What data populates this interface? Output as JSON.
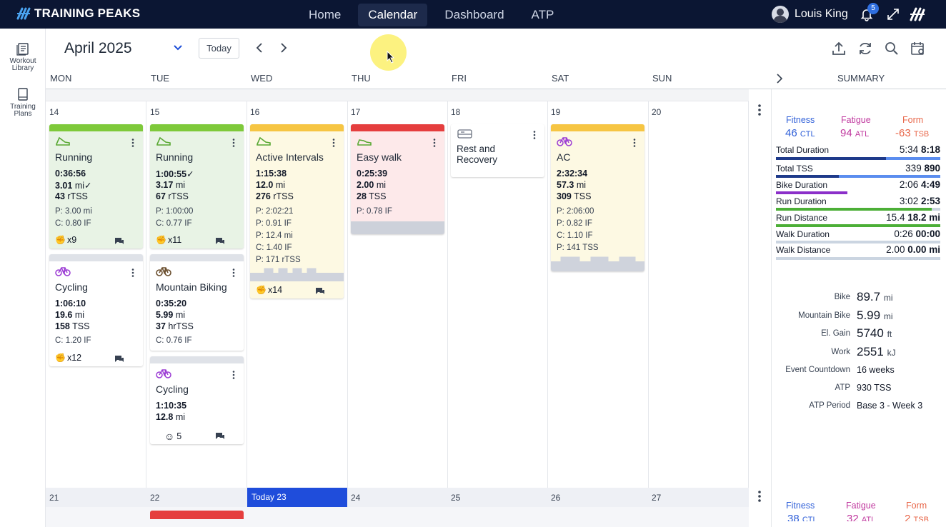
{
  "app": {
    "brand": "TRAINING PEAKS"
  },
  "nav": {
    "home": "Home",
    "calendar": "Calendar",
    "dashboard": "Dashboard",
    "atp": "ATP"
  },
  "user": {
    "name": "Louis King",
    "notifications": "5"
  },
  "leftbar": {
    "workout_library_1": "Workout",
    "workout_library_2": "Library",
    "training_plans_1": "Training",
    "training_plans_2": "Plans"
  },
  "header": {
    "month": "April 2025",
    "today_btn": "Today"
  },
  "days": [
    "MON",
    "TUE",
    "WED",
    "THU",
    "FRI",
    "SAT",
    "SUN"
  ],
  "summary_label": "SUMMARY",
  "week1": {
    "nums": [
      "14",
      "15",
      "16",
      "17",
      "18",
      "19",
      "20"
    ]
  },
  "week2": {
    "nums": [
      "21",
      "22",
      "Today 23",
      "24",
      "25",
      "26",
      "27"
    ]
  },
  "cards": {
    "mon_run": {
      "title": "Running",
      "dur": "0:36:56",
      "dist": "3.01",
      "dist_unit": "mi",
      "tss": "43",
      "tss_unit": "rTSS",
      "p": "P: 3.00 mi",
      "c": "C: 0.80 IF",
      "likes": "x9"
    },
    "mon_cyc": {
      "title": "Cycling",
      "dur": "1:06:10",
      "dist": "19.6",
      "dist_unit": "mi",
      "tss": "158",
      "tss_unit": "TSS",
      "c": "C: 1.20 IF",
      "likes": "x12"
    },
    "tue_run": {
      "title": "Running",
      "dur": "1:00:55",
      "dist": "3.17",
      "dist_unit": "mi",
      "tss": "67",
      "tss_unit": "rTSS",
      "p": "P: 1:00:00",
      "c": "C: 0.77 IF",
      "likes": "x11"
    },
    "tue_mtb": {
      "title": "Mountain Biking",
      "dur": "0:35:20",
      "dist": "5.99",
      "dist_unit": "mi",
      "tss": "37",
      "tss_unit": "hrTSS",
      "c": "C: 0.76 IF"
    },
    "tue_cyc": {
      "title": "Cycling",
      "dur": "1:10:35",
      "dist": "12.8",
      "dist_unit": "mi",
      "likes": "5"
    },
    "wed": {
      "title": "Active Intervals",
      "dur": "1:15:38",
      "dist": "12.0",
      "dist_unit": "mi",
      "tss": "276",
      "tss_unit": "rTSS",
      "p1": "P: 2:02:21",
      "p2": "P: 0.91 IF",
      "p3": "P: 12.4 mi",
      "c": "C: 1.40 IF",
      "p4": "P: 171 rTSS",
      "likes": "x14"
    },
    "thu": {
      "title": "Easy walk",
      "dur": "0:25:39",
      "dist": "2.00",
      "dist_unit": "mi",
      "tss": "28",
      "tss_unit": "TSS",
      "p": "P: 0.78 IF"
    },
    "fri": {
      "title1": "Rest and",
      "title2": "Recovery"
    },
    "sat": {
      "title": "AC",
      "dur": "2:32:34",
      "dist": "57.3",
      "dist_unit": "mi",
      "tss": "309",
      "tss_unit": "TSS",
      "p1": "P: 2:06:00",
      "p2": "P: 0.82 IF",
      "c": "C: 1.10 IF",
      "p3": "P: 141 TSS"
    }
  },
  "summary": {
    "fitness_label": "Fitness",
    "fitness_val": "46",
    "fitness_unit": "CTL",
    "fatigue_label": "Fatigue",
    "fatigue_val": "94",
    "fatigue_unit": "ATL",
    "form_label": "Form",
    "form_val": "-63",
    "form_unit": "TSB",
    "rows": [
      {
        "label": "Total Duration",
        "a": "5:34",
        "b": "8:18"
      },
      {
        "label": "Total TSS",
        "a": "339",
        "b": "890"
      },
      {
        "label": "Bike Duration",
        "a": "2:06",
        "b": "4:49"
      },
      {
        "label": "Run Duration",
        "a": "3:02",
        "b": "2:53"
      },
      {
        "label": "Run Distance",
        "a": "15.4",
        "b": "18.2 mi"
      },
      {
        "label": "Walk Duration",
        "a": "0:26",
        "b": "00:00"
      },
      {
        "label": "Walk Distance",
        "a": "2.00",
        "b": "0.00 mi"
      }
    ],
    "stats": [
      {
        "label": "Bike",
        "value": "89.7",
        "unit": "mi"
      },
      {
        "label": "Mountain Bike",
        "value": "5.99",
        "unit": "mi"
      },
      {
        "label": "El. Gain",
        "value": "5740",
        "unit": "ft"
      },
      {
        "label": "Work",
        "value": "2551",
        "unit": "kJ"
      },
      {
        "label": "Event Countdown",
        "value": "16 weeks",
        "unit": ""
      },
      {
        "label": "ATP",
        "value": "930",
        "unit": "TSS"
      },
      {
        "label": "ATP Period",
        "value": "Base 3 - Week 3",
        "unit": ""
      }
    ],
    "week2_fitness": "38",
    "week2_fitness_unit": "CTL",
    "week2_fatigue": "32",
    "week2_fatigue_unit": "ATL",
    "week2_form": "2",
    "week2_form_unit": "TSB"
  },
  "colors": {
    "navy": "#0b1633",
    "green": "#7ec93a",
    "yellow": "#f6c543",
    "red": "#e53e3e",
    "fitness": "#2f5fd8",
    "fatigue": "#c0399f",
    "form": "#e8674a",
    "today": "#1f4ddb"
  }
}
